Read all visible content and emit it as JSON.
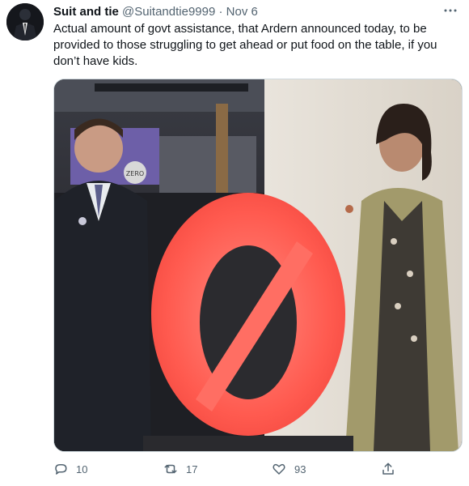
{
  "tweet": {
    "author_name": "Suit and tie",
    "handle": "@Suitandtie9999",
    "separator": "·",
    "timestamp": "Nov 6",
    "text": "Actual amount of govt assistance, that Ardern announced today, to be provided to those struggling to get ahead or put food on the table, if you don’t have kids.",
    "more_icon": "more-horizontal-icon",
    "media": {
      "sign_text": "ZERO",
      "colors": {
        "zero_sculpture": "#ff5a4f",
        "coat": "#a29a6b"
      }
    },
    "actions": {
      "reply_count": "10",
      "retweet_count": "17",
      "like_count": "93",
      "icons": [
        "reply-icon",
        "retweet-icon",
        "like-icon",
        "share-icon"
      ]
    }
  }
}
